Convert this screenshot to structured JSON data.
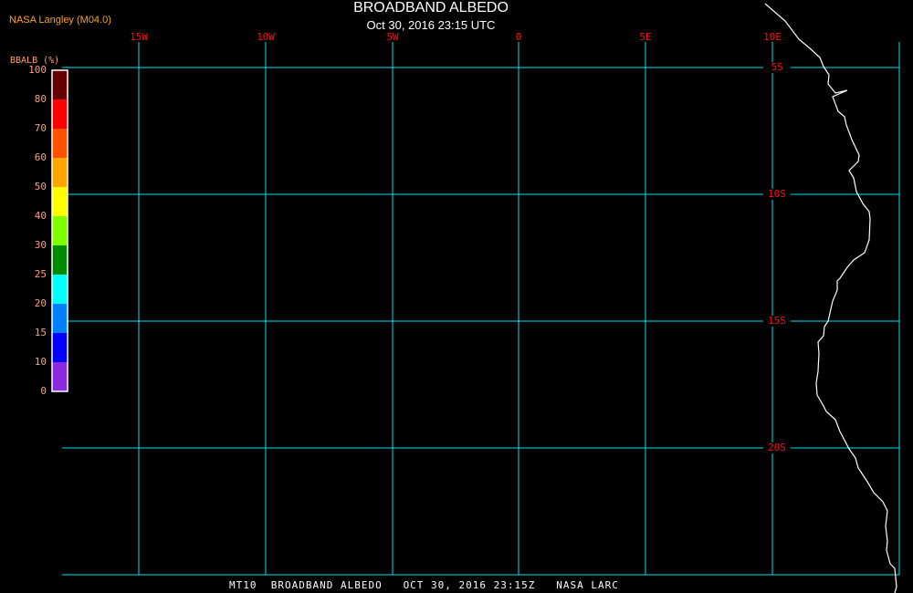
{
  "header": {
    "title": "BROADBAND ALBEDO",
    "subtitle": "Oct 30, 2016 23:15 UTC",
    "credit": "NASA Langley (M04.0)"
  },
  "legend": {
    "title": "BBALB (%)",
    "labels": [
      "100",
      "80",
      "70",
      "60",
      "50",
      "40",
      "30",
      "25",
      "20",
      "15",
      "10",
      "0"
    ],
    "colors": [
      "#660000",
      "#ff0000",
      "#ff5000",
      "#ffa500",
      "#ffff00",
      "#80ff00",
      "#008a00",
      "#00ffff",
      "#0080ff",
      "#0000ff",
      "#8a2be2"
    ]
  },
  "map": {
    "grid_color": "#00e5ee",
    "coastline_color": "#ffffff",
    "label_color": "#ff1010",
    "longitude_labels": [
      "15W",
      "10W",
      "5W",
      "0",
      "5E",
      "10E"
    ],
    "latitude_labels": [
      "5S",
      "10S",
      "15S",
      "20S"
    ]
  },
  "footer": {
    "text": "MT10  BROADBAND ALBEDO   OCT 30, 2016 23:15Z   NASA LARC"
  }
}
